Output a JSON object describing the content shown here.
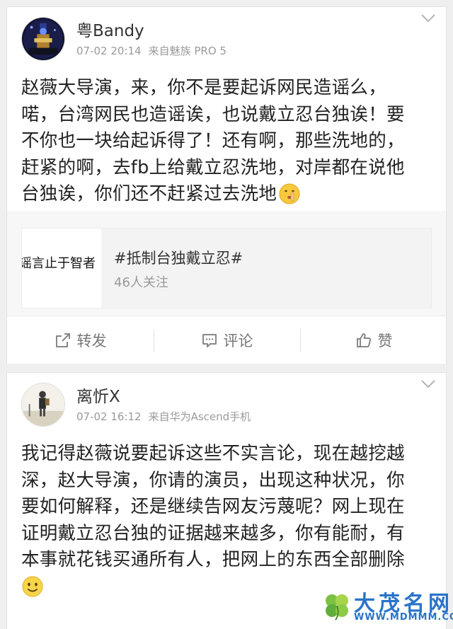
{
  "posts": [
    {
      "username": "粤Bandy",
      "time": "07-02 20:14",
      "source": "来自魅族 PRO 5",
      "text_lines": [
        "赵薇大导演，来，你不是要起诉网民造谣么，",
        "喏，台湾网民也造谣诶，也说戴立忍台独诶！要",
        "不你也一块给起诉得了！还有啊，那些洗地的，",
        "赶紧的啊，去fb上给戴立忍洗地，对岸都在说他",
        "台独诶，你们还不赶紧过去洗地"
      ],
      "emoji": "shush-emoji",
      "topic": {
        "thumb_text": "谣言止于智者",
        "title": "#抵制台独戴立忍#",
        "followers": "46人关注"
      },
      "actions": {
        "repost": "转发",
        "comment": "评论",
        "like": "赞"
      }
    },
    {
      "username": "离忻X",
      "time": "07-02 16:12",
      "source": "来自华为Ascend手机",
      "text_lines": [
        "我记得赵薇说要起诉这些不实言论，现在越挖越",
        "深，赵大导演，你请的演员，出现这种状况，你",
        "要如何解释，还是继续告网友污蔑呢？网上现在",
        "证明戴立忍台独的证据越来越多，你有能耐，有",
        "本事就花钱买通所有人，把网上的东西全部删除"
      ],
      "emoji": "smile-emoji"
    }
  ],
  "watermark": {
    "title": "大茂名网",
    "url": "WWW.MDMMM.COM"
  },
  "colors": {
    "accent": "#2a73c8",
    "meta_gray": "#9a9a9a",
    "background": "#efefef"
  }
}
